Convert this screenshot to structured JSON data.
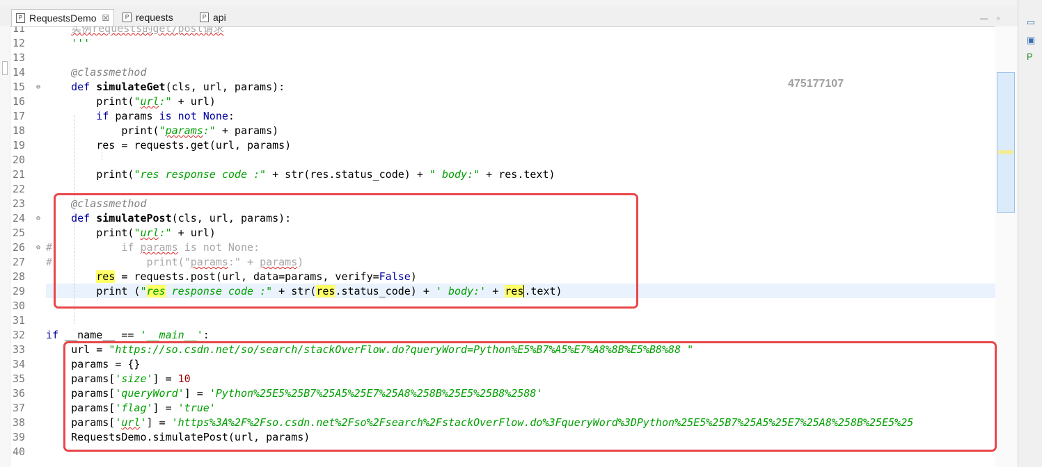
{
  "tabs": [
    {
      "label": "RequestsDemo",
      "icon": "python-file-icon",
      "active": true,
      "close": "☒"
    },
    {
      "label": "requests",
      "icon": "python-package-icon",
      "active": false
    },
    {
      "label": "api",
      "icon": "python-file-icon",
      "active": false
    }
  ],
  "watermark": "475177107",
  "editor_lines": [
    {
      "n": "11",
      "html": "<span class=\"cmt\">    <span class=\"squig\">实例requests的get/post请求</span></span>"
    },
    {
      "n": "12",
      "html": "    <span class=\"str\">'''</span>"
    },
    {
      "n": "13",
      "html": ""
    },
    {
      "n": "14",
      "html": "    <span class=\"dec\">@classmethod</span>"
    },
    {
      "n": "15",
      "fold": "⊖",
      "html": "    <span class=\"kw\">def</span> <span class=\"fn\">simulateGet</span>(cls, url, params):"
    },
    {
      "n": "16",
      "html": "        print(<span class=\"str\">\"<span class=\"squig\">url</span>:\"</span> + url)"
    },
    {
      "n": "17",
      "html": "        <span class=\"kw\">if</span> params <span class=\"kw\">is not</span> <span class=\"const\">None</span>:"
    },
    {
      "n": "18",
      "html": "            print(<span class=\"str\">\"<span class=\"squig\">params</span>:\"</span> + params)"
    },
    {
      "n": "19",
      "html": "        res = requests.get(url, params)"
    },
    {
      "n": "20",
      "html": ""
    },
    {
      "n": "21",
      "html": "        print(<span class=\"str\">\"res response code :\"</span> + str(res.status_code) + <span class=\"str\">\" body:\"</span> + res.text)"
    },
    {
      "n": "22",
      "html": ""
    },
    {
      "n": "23",
      "html": "    <span class=\"dec\">@classmethod</span>"
    },
    {
      "n": "24",
      "fold": "⊖",
      "html": "    <span class=\"kw\">def</span> <span class=\"fn\">simulatePost</span>(cls, url, params):"
    },
    {
      "n": "25",
      "html": "        print(<span class=\"str\">\"<span class=\"squig\">url</span>:\"</span> + url)"
    },
    {
      "n": "26",
      "fold": "⊖",
      "html": "<span class=\"cmt\">#           if <span class=\"squig\">params</span> is not None:</span>"
    },
    {
      "n": "27",
      "html": "<span class=\"cmt\">#               print(\"<span class=\"squig\">params</span>:\" + <span class=\"squig\">params</span>)</span>"
    },
    {
      "n": "28",
      "html": "        <span class=\"hl\">res</span> = requests.post(url, data=params, verify=<span class=\"const\">False</span>)"
    },
    {
      "n": "29",
      "html": "        print (<span class=\"str\">\"<span class=\"hl\">res</span> response code :\"</span> + str(<span class=\"hl\">res</span>.status_code) + <span class=\"str\">' body:'</span> + <span class=\"hl\">res</span><span class=\"cur\"></span>.text)"
    },
    {
      "n": "30",
      "html": ""
    },
    {
      "n": "31",
      "html": ""
    },
    {
      "n": "32",
      "html": "<span class=\"kw\">if</span> __name__ == <span class=\"str\">'__main__'</span>:"
    },
    {
      "n": "33",
      "html": "    url = <span class=\"str\">\"https://so.csdn.net/so/search/stackOverFlow.do?queryWord=Python%E5%B7%A5%E7%A8%8B%E5%B8%88 \"</span>"
    },
    {
      "n": "34",
      "html": "    params = {}"
    },
    {
      "n": "35",
      "html": "    params[<span class=\"str\">'size'</span>] = <span class=\"num\">10</span>"
    },
    {
      "n": "36",
      "html": "    params[<span class=\"str\">'queryWord'</span>] = <span class=\"str\">'Python%25E5%25B7%25A5%25E7%25A8%258B%25E5%25B8%2588'</span>"
    },
    {
      "n": "37",
      "html": "    params[<span class=\"str\">'flag'</span>] = <span class=\"str\">'true'</span>"
    },
    {
      "n": "38",
      "html": "    params[<span class=\"str\">'<span class=\"squig\">url</span>'</span>] = <span class=\"str\">'https%3A%2F%2Fso.csdn.net%2Fso%2Fsearch%2FstackOverFlow.do%3FqueryWord%3DPython%25E5%25B7%25A5%25E7%25A8%258B%25E5%25</span>"
    },
    {
      "n": "39",
      "html": "    RequestsDemo.simulatePost(url, params)"
    },
    {
      "n": "40",
      "html": ""
    }
  ],
  "colors": {
    "annotation": "#e8474a",
    "keyword": "#0000a0",
    "string": "#00a000",
    "highlight": "#ffff66"
  }
}
